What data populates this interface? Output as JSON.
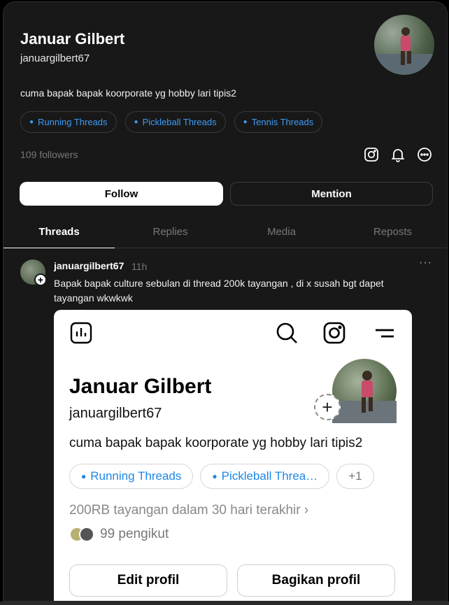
{
  "profile": {
    "name": "Januar Gilbert",
    "handle": "januargilbert67",
    "bio": "cuma bapak bapak koorporate yg hobby lari tipis2",
    "chips": [
      "Running Threads",
      "Pickleball Threads",
      "Tennis Threads"
    ],
    "followers": "109 followers",
    "icons": [
      "instagram-icon",
      "bell-icon",
      "more-circle-icon"
    ],
    "follow_label": "Follow",
    "mention_label": "Mention"
  },
  "tabs": [
    "Threads",
    "Replies",
    "Media",
    "Reposts"
  ],
  "post": {
    "user": "januargilbert67",
    "time": "11h",
    "more": "···",
    "text": "Bapak bapak culture sebulan di thread 200k tayangan , di x susah bgt dapet tayangan wkwkwk",
    "embedded": {
      "name": "Januar Gilbert",
      "handle": "januargilbert67",
      "bio": "cuma bapak bapak koorporate yg hobby lari tipis2",
      "chips": [
        "Running Threads",
        "Pickleball Threa…",
        "+1"
      ],
      "views": "200RB tayangan dalam 30 hari terakhir",
      "followers": "99 pengikut",
      "edit_label": "Edit profil",
      "share_label": "Bagikan profil",
      "icons": [
        "insights-icon",
        "search-icon",
        "instagram-icon",
        "menu-icon"
      ]
    }
  },
  "colors": {
    "accent": "#3d9bf5",
    "background": "#181818"
  }
}
